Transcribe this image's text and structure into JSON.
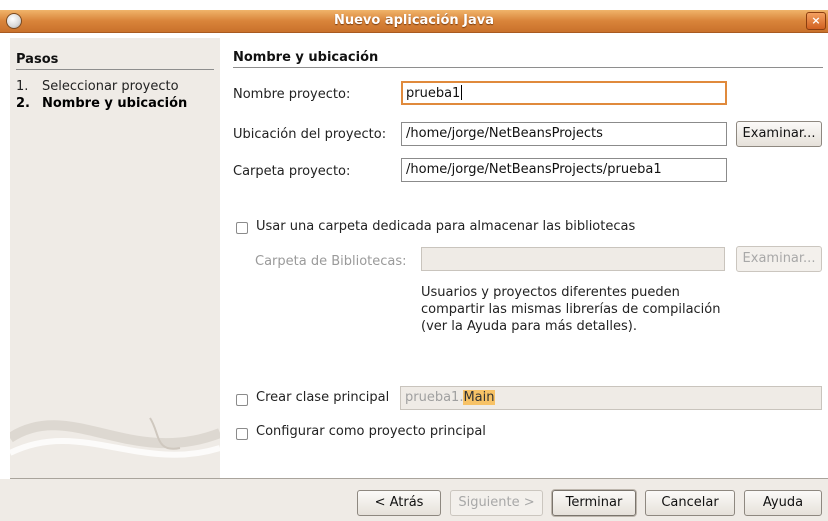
{
  "window": {
    "title": "Nuevo  aplicación Java",
    "close_label": "×"
  },
  "steps": {
    "title": "Pasos",
    "items": [
      {
        "num": "1.",
        "label": "Seleccionar proyecto"
      },
      {
        "num": "2.",
        "label": "Nombre y ubicación"
      }
    ]
  },
  "section": {
    "title": "Nombre y ubicación"
  },
  "form": {
    "project_name_label": "Nombre proyecto:",
    "project_name_value": "prueba1",
    "project_location_label": "Ubicación del proyecto:",
    "project_location_value": "/home/jorge/NetBeansProjects",
    "browse_label": "Examinar...",
    "project_folder_label": "Carpeta proyecto:",
    "project_folder_value": "/home/jorge/NetBeansProjects/prueba1",
    "dedicated_folder_label": "Usar una carpeta dedicada para almacenar las bibliotecas",
    "library_folder_label": "Carpeta de Bibliotecas:",
    "library_folder_value": "",
    "library_browse_label": "Examinar...",
    "library_description": "Usuarios y proyectos diferentes pueden compartir las mismas librerías de compilación (ver la Ayuda para más detalles).",
    "main_class_label": "Crear clase principal",
    "main_class_prefix": "prueba1.",
    "main_class_name": "Main",
    "set_main_project_label": "Configurar como proyecto principal"
  },
  "buttons": {
    "back": "< Atrás",
    "next": "Siguiente >",
    "finish": "Terminar",
    "cancel": "Cancelar",
    "help": "Ayuda"
  }
}
